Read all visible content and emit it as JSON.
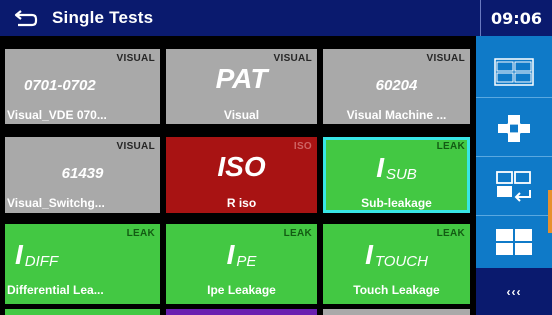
{
  "header": {
    "title": "Single Tests",
    "time": "09:06"
  },
  "tiles": [
    {
      "category": "VISUAL",
      "big": "0701-0702",
      "name": "Visual_VDE 070..."
    },
    {
      "category": "VISUAL",
      "big": "PAT",
      "name": "Visual"
    },
    {
      "category": "VISUAL",
      "big": "60204",
      "name": "Visual Machine ..."
    },
    {
      "category": "VISUAL",
      "big": "61439",
      "name": "Visual_Switchg..."
    },
    {
      "category": "ISO",
      "big": "ISO",
      "name": "R iso"
    },
    {
      "category": "LEAK",
      "big_main": "I",
      "big_sub": "SUB",
      "name": "Sub-leakage"
    },
    {
      "category": "LEAK",
      "big_main": "I",
      "big_sub": "DIFF",
      "name": "Differential Lea..."
    },
    {
      "category": "LEAK",
      "big_main": "I",
      "big_sub": "PE",
      "name": "Ipe Leakage"
    },
    {
      "category": "LEAK",
      "big_main": "I",
      "big_sub": "TOUCH",
      "name": "Touch Leakage"
    }
  ],
  "sidebar": {
    "more_label": "‹‹‹"
  },
  "icons": [
    "back-arrow-icon",
    "grid-view-icon",
    "cross-layout-icon",
    "switch-view-icon",
    "split-view-icon"
  ],
  "colors": {
    "titlebar": "#0a1a6e",
    "sidebar": "#0f7ac8",
    "grey_tile": "#a9a9a9",
    "red_tile": "#a81313",
    "green_tile": "#43c843",
    "selection": "#38e6e6",
    "marker": "#e7902d"
  }
}
